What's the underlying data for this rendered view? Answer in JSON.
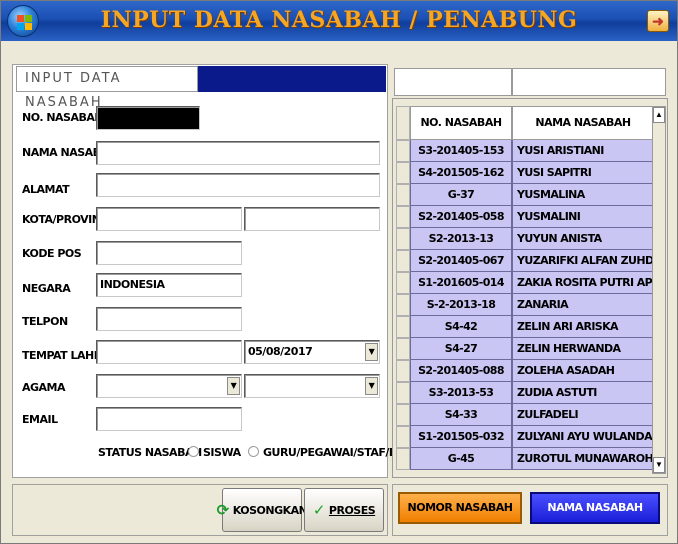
{
  "window": {
    "title": "INPUT DATA NASABAH / PENABUNG",
    "exit_icon": "exit-arrow-icon"
  },
  "form": {
    "tab_label": "INPUT DATA NASABAH",
    "labels": {
      "no_nasabah": "NO. NASABAH",
      "nama": "NAMA NASABAH",
      "alamat": "ALAMAT",
      "kota": "KOTA/PROVINSI",
      "kode_pos": "KODE POS",
      "negara": "NEGARA",
      "telpon": "TELPON",
      "tempat_lahir": "TEMPAT LAHIR",
      "agama": "AGAMA",
      "email": "EMAIL",
      "status": "STATUS NASABAH"
    },
    "values": {
      "no_nasabah": "",
      "nama": "",
      "alamat": "",
      "kota": "",
      "provinsi": "",
      "kode_pos": "",
      "negara": "INDONESIA",
      "telpon": "",
      "tempat_lahir": "",
      "tanggal_lahir": "05/08/2017",
      "agama": "",
      "agama2": "",
      "email": ""
    },
    "status_options": [
      "SISWA",
      "GURU/PEGAWAI/STAF/DLL"
    ],
    "buttons": {
      "kosongkan": "KOSONGKAN",
      "proses": "PROSES"
    }
  },
  "list": {
    "columns": [
      "NO. NASABAH",
      "NAMA NASABAH"
    ],
    "rows": [
      [
        "S3-201405-153",
        "YUSI ARISTIANI"
      ],
      [
        "S4-201505-162",
        "YUSI SAPITRI"
      ],
      [
        "G-37",
        "YUSMALINA"
      ],
      [
        "S2-201405-058",
        "YUSMALINI"
      ],
      [
        "S2-2013-13",
        "YUYUN ANISTA"
      ],
      [
        "S2-201405-067",
        "YUZARIFKI ALFAN ZUHDHI"
      ],
      [
        "S1-201605-014",
        "ZAKIA ROSITA PUTRI APRILIA"
      ],
      [
        "S-2-2013-18",
        "ZANARIA"
      ],
      [
        "S4-42",
        "ZELIN ARI ARISKA"
      ],
      [
        "S4-27",
        "ZELIN HERWANDA"
      ],
      [
        "S2-201405-088",
        "ZOLEHA ASADAH"
      ],
      [
        "S3-2013-53",
        "ZUDIA ASTUTI"
      ],
      [
        "S4-33",
        "ZULFADELI"
      ],
      [
        "S1-201505-032",
        "ZULYANI AYU WULANDARI"
      ],
      [
        "G-45",
        "ZUROTUL MUNAWAROH"
      ]
    ],
    "buttons": {
      "nomor": "NOMOR NASABAH",
      "nama": "NAMA NASABAH"
    }
  }
}
